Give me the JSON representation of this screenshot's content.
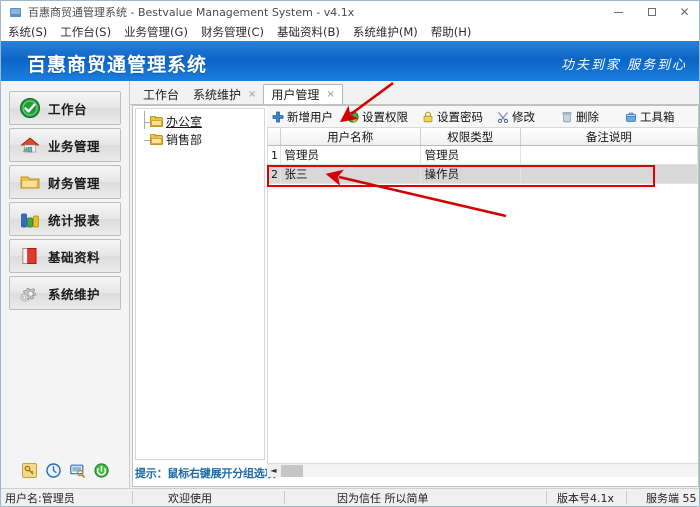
{
  "window": {
    "title": "百惠商贸通管理系统 - Bestvalue Management System - v4.1x",
    "minimize_label": "",
    "maximize_label": "",
    "close_label": "✕"
  },
  "menubar": {
    "items": [
      {
        "label": "系统(S)"
      },
      {
        "label": "工作台(S)"
      },
      {
        "label": "业务管理(G)"
      },
      {
        "label": "财务管理(C)"
      },
      {
        "label": "基础资料(B)"
      },
      {
        "label": "系统维护(M)"
      },
      {
        "label": "帮助(H)"
      }
    ]
  },
  "banner": {
    "title": "百惠商贸通管理系统",
    "slogan": "功夫到家 服务到心",
    "color": "#0a64c6"
  },
  "sidebar": {
    "items": [
      {
        "label": "工作台",
        "icon": "check-circle-icon"
      },
      {
        "label": "业务管理",
        "icon": "house-icon"
      },
      {
        "label": "财务管理",
        "icon": "folder-icon"
      },
      {
        "label": "统计报表",
        "icon": "bar-chart-icon"
      },
      {
        "label": "基础资料",
        "icon": "book-icon"
      },
      {
        "label": "系统维护",
        "icon": "gears-icon"
      }
    ],
    "footer_icons": [
      {
        "name": "key-icon"
      },
      {
        "name": "clock-icon"
      },
      {
        "name": "monitor-search-icon"
      },
      {
        "name": "power-icon"
      }
    ]
  },
  "tabs": [
    {
      "label": "工作台",
      "closable": false,
      "active": false
    },
    {
      "label": "系统维护",
      "closable": true,
      "active": false,
      "close": "×"
    },
    {
      "label": "用户管理",
      "closable": true,
      "active": true,
      "close": "×"
    }
  ],
  "toolbar": {
    "items": [
      {
        "label": "新增用户",
        "icon": "plus-icon"
      },
      {
        "label": "设置权限",
        "icon": "permission-icon"
      },
      {
        "label": "设置密码",
        "icon": "lock-icon"
      },
      {
        "label": "修改",
        "icon": "edit-icon"
      },
      {
        "label": "删除",
        "icon": "trash-icon"
      },
      {
        "label": "工具箱",
        "icon": "toolbox-icon"
      }
    ]
  },
  "tree": {
    "nodes": [
      {
        "label": "办公室",
        "selected": true
      },
      {
        "label": "销售部",
        "selected": false
      }
    ],
    "hint": "提示：鼠标右键展开分组选项"
  },
  "grid": {
    "columns": [
      "",
      "用户名称",
      "权限类型",
      "备注说明"
    ],
    "rows": [
      {
        "index": "1",
        "用户名称": "管理员",
        "权限类型": "管理员",
        "备注说明": "",
        "selected": false
      },
      {
        "index": "2",
        "用户名称": "张三",
        "权限类型": "操作员",
        "备注说明": "",
        "selected": true
      }
    ]
  },
  "statusbar": {
    "user": "用户名:管理员",
    "welcome": "欢迎使用",
    "motto": "因为信任 所以简单",
    "version": "版本号4.1x",
    "server": "服务端 55"
  },
  "annotations": {
    "highlight_color": "#e00000",
    "arrow_to_permission": "设置权限",
    "arrow_to_row": "张三"
  }
}
